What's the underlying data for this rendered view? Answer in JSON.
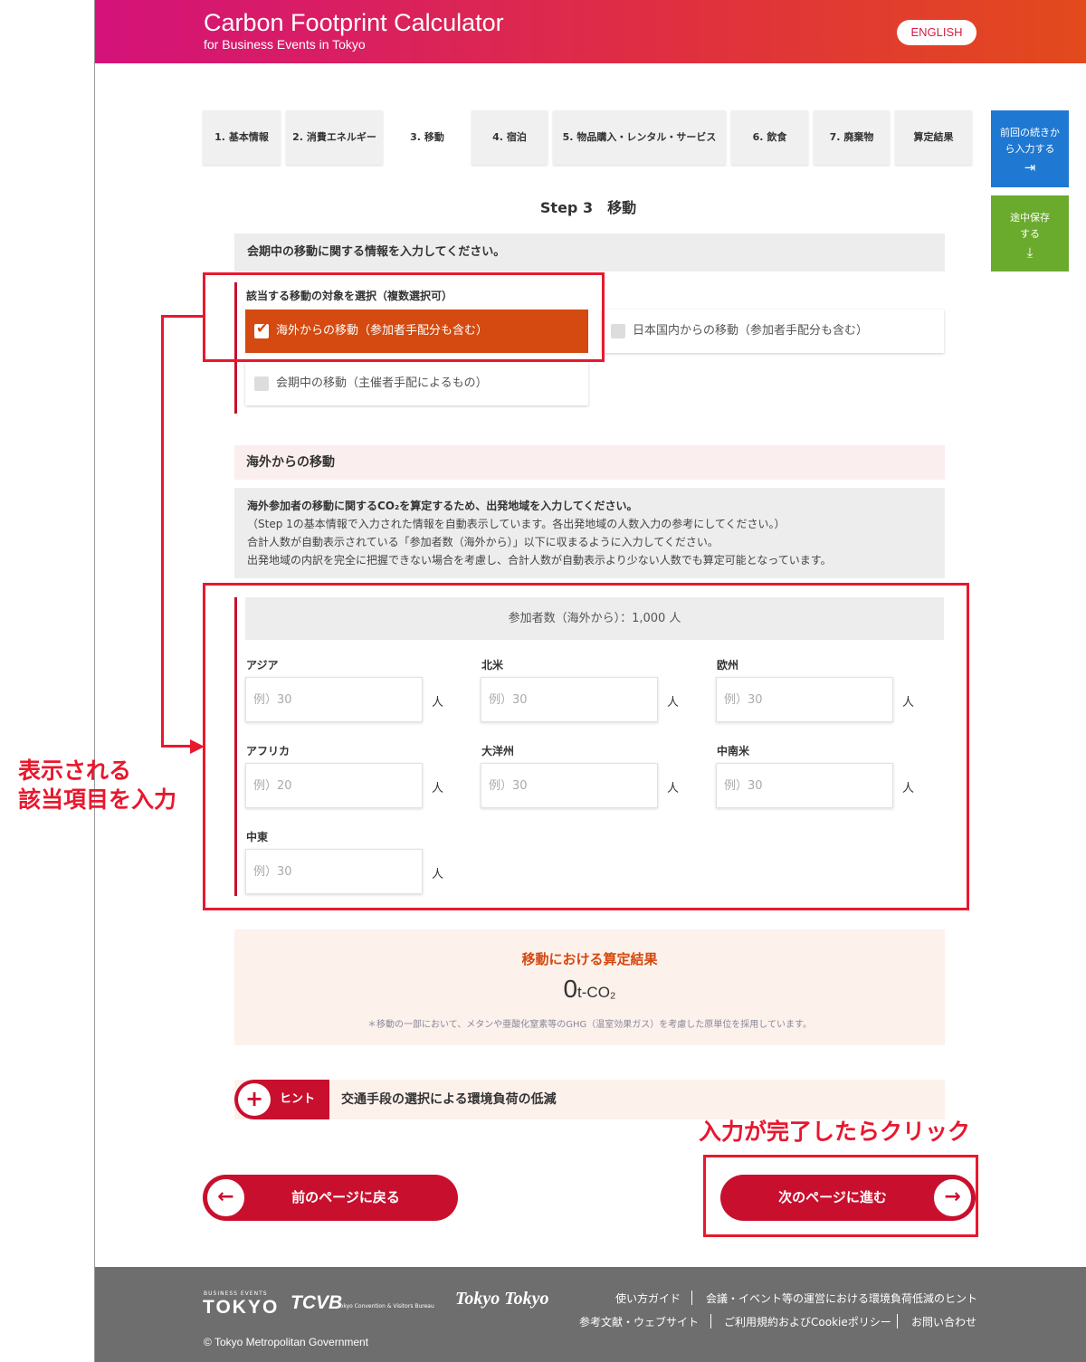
{
  "header": {
    "title": "Carbon Footprint Calculator",
    "subtitle": "for Business Events in Tokyo",
    "lang_button": "ENGLISH"
  },
  "side": {
    "resume_label": "前回の続きから入力する",
    "resume_icon": "login-icon",
    "save_label": "途中保存する",
    "save_icon": "download-icon"
  },
  "tabs": [
    {
      "label": "1. 基本情報"
    },
    {
      "label": "2. 消費エネルギー"
    },
    {
      "label": "3. 移動",
      "active": true
    },
    {
      "label": "4. 宿泊"
    },
    {
      "label": "5. 物品購入・レンタル・サービス"
    },
    {
      "label": "6. 飲食"
    },
    {
      "label": "7. 廃棄物"
    },
    {
      "label": "算定結果"
    }
  ],
  "step": {
    "title": "Step 3　移動",
    "intro": "会期中の移動に関する情報を入力してください。"
  },
  "selection": {
    "label": "該当する移動の対象を選択（複数選択可）",
    "options": [
      {
        "label": "海外からの移動（参加者手配分も含む）",
        "checked": true
      },
      {
        "label": "日本国内からの移動（参加者手配分も含む）",
        "checked": false
      },
      {
        "label": "会期中の移動（主催者手配によるもの）",
        "checked": false
      }
    ]
  },
  "overseas": {
    "section_title": "海外からの移動",
    "instruction_lead": "海外参加者の移動に関するCO₂を算定するため、出発地域を入力してください。",
    "instruction_lines": [
      "（Step 1の基本情報で入力された情報を自動表示しています。各出発地域の人数入力の参考にしてください。）",
      "合計人数が自動表示されている「参加者数（海外から）」以下に収まるように入力してください。",
      "出発地域の内訳を完全に把握できない場合を考慮し、合計人数が自動表示より少ない人数でも算定可能となっています。"
    ],
    "participant_count": "参加者数（海外から）：1,000 人",
    "unit": "人",
    "regions": [
      {
        "label": "アジア",
        "placeholder": "例）30"
      },
      {
        "label": "北米",
        "placeholder": "例）30"
      },
      {
        "label": "欧州",
        "placeholder": "例）30"
      },
      {
        "label": "アフリカ",
        "placeholder": "例）20"
      },
      {
        "label": "大洋州",
        "placeholder": "例）30"
      },
      {
        "label": "中南米",
        "placeholder": "例）30"
      },
      {
        "label": "中東",
        "placeholder": "例）30"
      }
    ]
  },
  "result": {
    "title": "移動における算定結果",
    "value": "0",
    "unit": "t-CO₂",
    "note": "＊移動の一部において、メタンや亜酸化窒素等のGHG（温室効果ガス）を考慮した原単位を採用しています。"
  },
  "hint": {
    "tag": "ヒント",
    "text": "交通手段の選択による環境負荷の低減"
  },
  "nav": {
    "prev": "前のページに戻る",
    "next": "次のページに進む"
  },
  "footer": {
    "logo_business_events": "BUSINESS EVENTS",
    "logo_tokyo": "TOKYO",
    "logo_tcvb": "TCVB",
    "logo_tcvb_sub": "Tokyo Convention & Visitors Bureau",
    "logo_tokyotokyo": "Tokyo Tokyo",
    "links_row1": [
      "使い方ガイド",
      "会議・イベント等の運営における環境負荷低減のヒント"
    ],
    "links_row2": [
      "参考文献・ウェブサイト",
      "ご利用規約およびCookieポリシー",
      "お問い合わせ"
    ],
    "copyright": "© Tokyo Metropolitan Government"
  },
  "annotations": {
    "regions_note_line1": "表示される",
    "regions_note_line2": "該当項目を入力",
    "next_note": "入力が完了したらクリック",
    "color": "#e8182e"
  },
  "colors": {
    "brand_red": "#c8102e",
    "checked_orange": "#d44a10",
    "resume_blue": "#1f78d1",
    "save_green": "#6aab2e"
  }
}
